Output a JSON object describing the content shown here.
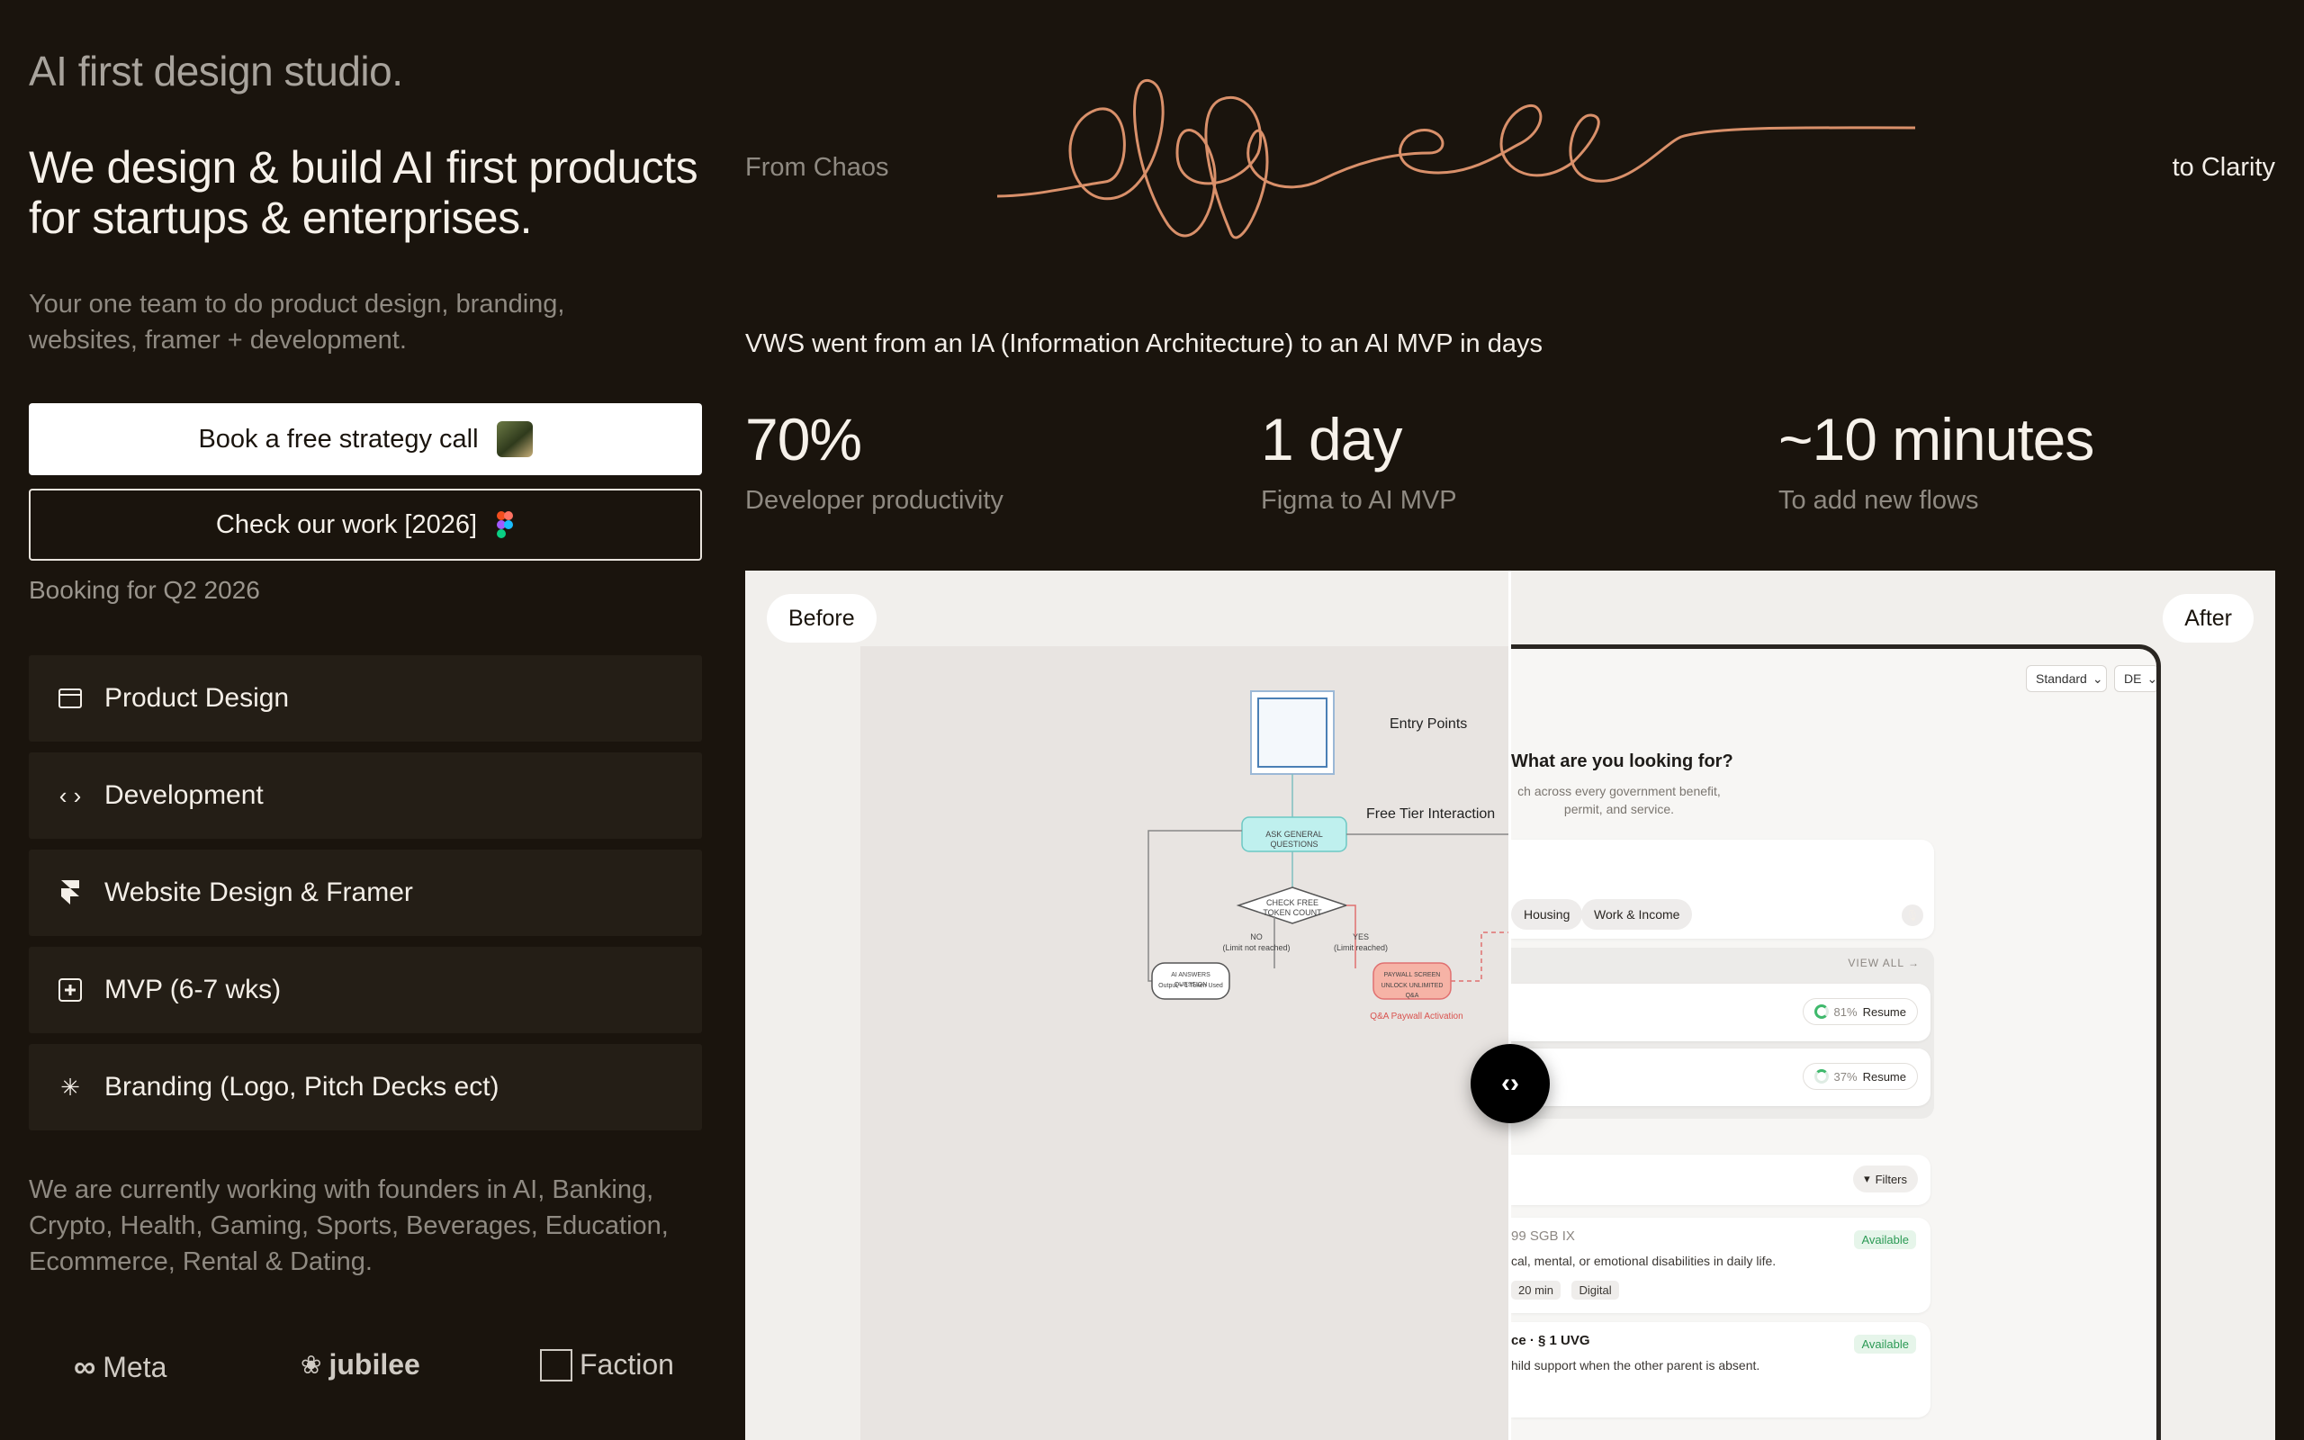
{
  "hero": {
    "studio_title": "AI first design studio.",
    "headline": "We design & build AI first products for startups & enterprises.",
    "subtitle": "Your one team to do product design, branding, websites, framer + development."
  },
  "cta": {
    "primary_label": "Book a free strategy call",
    "secondary_label": "Check our work [2026]",
    "booking_note": "Booking for Q2 2026"
  },
  "services": [
    {
      "label": "Product Design",
      "icon": "window-icon"
    },
    {
      "label": "Development",
      "icon": "code-icon"
    },
    {
      "label": "Website Design & Framer",
      "icon": "framer-icon"
    },
    {
      "label": "MVP (6-7 wks)",
      "icon": "plus-box-icon"
    },
    {
      "label": "Branding (Logo, Pitch Decks ect)",
      "icon": "sparkle-icon"
    }
  ],
  "working_with": "We are currently working with founders in AI,   Banking, Crypto, Health, Gaming, Sports, Beverages, Education, Ecommerce, Rental & Dating.",
  "clients": [
    "Meta",
    "jubilee",
    "Faction"
  ],
  "transformation": {
    "from_label": "From Chaos",
    "to_label": "to Clarity",
    "line_color": "#d9906a"
  },
  "case_study": {
    "title": "VWS went from an IA (Information Architecture) to an AI MVP in days",
    "stats": [
      {
        "value": "70%",
        "label": "Developer productivity"
      },
      {
        "value": "1 day",
        "label": "Figma to AI MVP"
      },
      {
        "value": "~10 minutes",
        "label": "To add new flows"
      }
    ]
  },
  "compare": {
    "before_label": "Before",
    "after_label": "After",
    "before": {
      "entry_points": "Entry Points",
      "free_tier": "Free Tier Interaction",
      "ask_general": "ASK GENERAL QUESTIONS",
      "check_token": "CHECK FREE TOKEN COUNT",
      "no_branch": "NO",
      "no_sub": "(Limit not reached)",
      "yes_branch": "YES",
      "yes_sub": "(Limit reached)",
      "ai_answers": "AI ANSWERS QUESTION",
      "ai_answers_sub": "Output + 1 Token Used",
      "paywall": "PAYWALL SCREEN",
      "paywall_sub": "UNLOCK UNLIMITED Q&A",
      "paywall_activation": "Q&A Paywall Activation"
    },
    "after": {
      "select_standard": "Standard",
      "select_lang": "DE",
      "question": "What are you looking for?",
      "description": "ch across every government benefit, permit, and service.",
      "chips": [
        "Housing",
        "Work & Income"
      ],
      "view_all": "VIEW ALL →",
      "progress": [
        {
          "percent": "81%",
          "action": "Resume"
        },
        {
          "percent": "37%",
          "action": "Resume"
        }
      ],
      "filters_label": "Filters",
      "results": [
        {
          "ref": "99 SGB IX",
          "desc": "cal, mental, or emotional disabilities in daily life.",
          "status": "Available",
          "tags": [
            "20 min",
            "Digital"
          ]
        },
        {
          "ref": "ce · § 1 UVG",
          "desc": "hild support when the other parent is absent.",
          "status": "Available",
          "tags": []
        }
      ]
    }
  }
}
